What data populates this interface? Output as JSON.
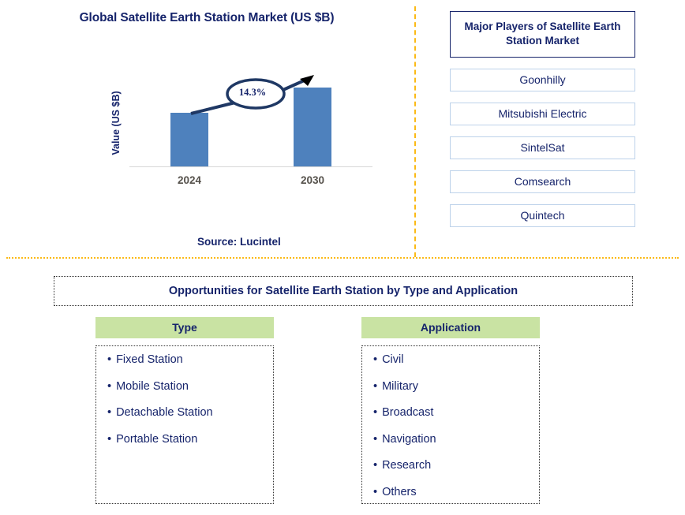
{
  "chart_panel": {
    "title": "Global Satellite Earth Station Market (US $B)",
    "source": "Source: Lucintel"
  },
  "chart_data": {
    "type": "bar",
    "title": "Global Satellite Earth Station Market (US $B)",
    "categories": [
      "2024",
      "2030"
    ],
    "values": [
      61,
      89
    ],
    "xlabel": "",
    "ylabel": "Value (US $B)",
    "annotations": [
      {
        "label": "14.3%",
        "type": "cagr-callout",
        "from": "2024",
        "to": "2030"
      }
    ],
    "grid": false,
    "legend": "none",
    "series_color": "#4E81BD"
  },
  "players": {
    "header": "Major Players of Satellite Earth Station Market",
    "items": [
      {
        "name": "Goonhilly"
      },
      {
        "name": "Mitsubishi Electric"
      },
      {
        "name": "SintelSat"
      },
      {
        "name": "Comsearch"
      },
      {
        "name": "Quintech"
      }
    ]
  },
  "opportunities": {
    "banner": "Opportunities for Satellite Earth Station by Type and Application",
    "columns": [
      {
        "header": "Type",
        "items": [
          "Fixed Station",
          "Mobile Station",
          "Detachable Station",
          "Portable Station"
        ]
      },
      {
        "header": "Application",
        "items": [
          "Civil",
          "Military",
          "Broadcast",
          "Navigation",
          "Research",
          "Others"
        ]
      }
    ]
  },
  "colors": {
    "navy": "#16246B",
    "bar_blue": "#4E81BD",
    "divider_orange": "#FBBA17",
    "header_green": "#C9E3A3"
  }
}
